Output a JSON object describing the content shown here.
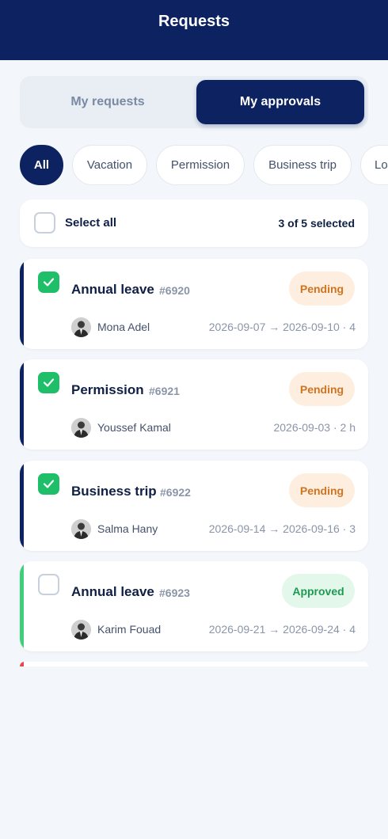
{
  "header": {
    "title": "Requests"
  },
  "segments": {
    "my_requests": "My requests",
    "my_approvals": "My approvals",
    "active": "my_approvals"
  },
  "filters": [
    "All",
    "Vacation",
    "Permission",
    "Business trip",
    "Lo"
  ],
  "active_filter": "All",
  "select_bar": {
    "label": "Select all",
    "count": "3 of 5 selected",
    "checked": false
  },
  "colors": {
    "navy": "#0d2260",
    "green": "#1fbe68",
    "pending": "#cf7420",
    "approved": "#1f9a52",
    "rejected": "#e5484d"
  },
  "requests": [
    {
      "title": "Annual leave",
      "id": "#6920",
      "status": "Pending",
      "person": "Mona Adel",
      "date": "2026-09-07 → 2026-09-10 · 4",
      "checked": true,
      "avatar_icon": "avatar-icon"
    },
    {
      "title": "Permission",
      "id": "#6921",
      "status": "Pending",
      "person": "Youssef Kamal",
      "date": "2026-09-03 · 2 h",
      "checked": true,
      "avatar_icon": "avatar-icon"
    },
    {
      "title": "Business trip",
      "id": "#6922",
      "status": "Pending",
      "person": "Salma Hany",
      "date": "2026-09-14 → 2026-09-16 · 3",
      "checked": true,
      "avatar_icon": "avatar-icon"
    },
    {
      "title": "Annual leave",
      "id": "#6923",
      "status": "Approved",
      "person": "Karim Fouad",
      "date": "2026-09-21 → 2026-09-24 · 4",
      "checked": false,
      "avatar_icon": "avatar-icon"
    }
  ]
}
